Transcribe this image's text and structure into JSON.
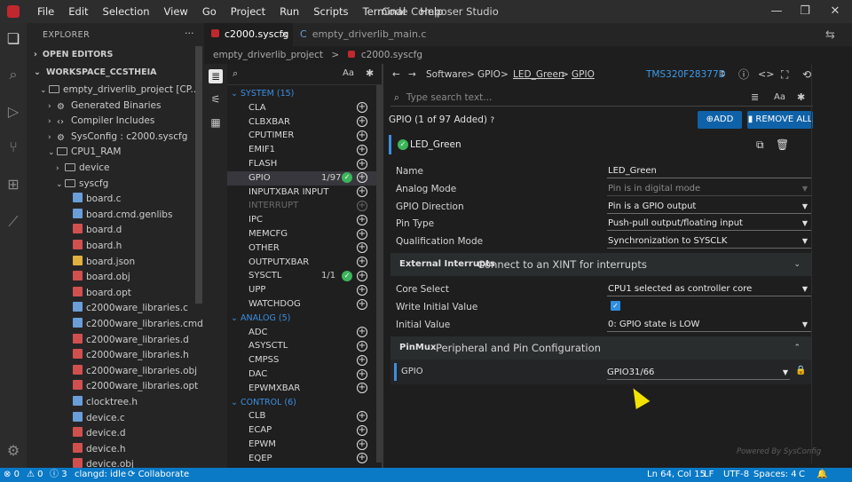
{
  "titlebar": {
    "menu": [
      "File",
      "Edit",
      "Selection",
      "View",
      "Go",
      "Project",
      "Run",
      "Scripts",
      "Terminal",
      "Help"
    ],
    "title": "Code Composer Studio"
  },
  "explorer": {
    "header": "EXPLORER",
    "open_editors": "OPEN EDITORS",
    "workspace": "WORKSPACE_CCSTHEIA",
    "tree": [
      {
        "label": "empty_driverlib_project [CP...",
        "indent": 1,
        "chev": "v",
        "icon": "folder"
      },
      {
        "label": "Generated Binaries",
        "indent": 2,
        "chev": ">",
        "icon": "gear"
      },
      {
        "label": "Compiler Includes",
        "indent": 2,
        "chev": ">",
        "icon": "code"
      },
      {
        "label": "SysConfig : c2000.syscfg",
        "indent": 2,
        "chev": ">",
        "icon": "gear"
      },
      {
        "label": "CPU1_RAM",
        "indent": 2,
        "chev": "v",
        "icon": "folder"
      },
      {
        "label": "device",
        "indent": 3,
        "chev": ">",
        "icon": "folder"
      },
      {
        "label": "syscfg",
        "indent": 3,
        "chev": "v",
        "icon": "folder"
      },
      {
        "label": "board.c",
        "indent": 4,
        "chev": "",
        "icon": "c"
      },
      {
        "label": "board.cmd.genlibs",
        "indent": 4,
        "chev": "",
        "icon": "c"
      },
      {
        "label": "board.d",
        "indent": 4,
        "chev": "",
        "icon": "red"
      },
      {
        "label": "board.h",
        "indent": 4,
        "chev": "",
        "icon": "red"
      },
      {
        "label": "board.json",
        "indent": 4,
        "chev": "",
        "icon": "yellow"
      },
      {
        "label": "board.obj",
        "indent": 4,
        "chev": "",
        "icon": "red"
      },
      {
        "label": "board.opt",
        "indent": 4,
        "chev": "",
        "icon": "red"
      },
      {
        "label": "c2000ware_libraries.c",
        "indent": 4,
        "chev": "",
        "icon": "c"
      },
      {
        "label": "c2000ware_libraries.cmd....",
        "indent": 4,
        "chev": "",
        "icon": "c"
      },
      {
        "label": "c2000ware_libraries.d",
        "indent": 4,
        "chev": "",
        "icon": "red"
      },
      {
        "label": "c2000ware_libraries.h",
        "indent": 4,
        "chev": "",
        "icon": "red"
      },
      {
        "label": "c2000ware_libraries.obj",
        "indent": 4,
        "chev": "",
        "icon": "red"
      },
      {
        "label": "c2000ware_libraries.opt",
        "indent": 4,
        "chev": "",
        "icon": "red"
      },
      {
        "label": "clocktree.h",
        "indent": 4,
        "chev": "",
        "icon": "c"
      },
      {
        "label": "device.c",
        "indent": 4,
        "chev": "",
        "icon": "c"
      },
      {
        "label": "device.d",
        "indent": 4,
        "chev": "",
        "icon": "red"
      },
      {
        "label": "device.h",
        "indent": 4,
        "chev": "",
        "icon": "red"
      },
      {
        "label": "device.obj",
        "indent": 4,
        "chev": "",
        "icon": "red"
      }
    ]
  },
  "tabs": [
    {
      "label": "c2000.syscfg",
      "close": "×"
    },
    {
      "label": "empty_driverlib_main.c"
    }
  ],
  "breadcrumb": {
    "project": "empty_driverlib_project",
    "sep": ">",
    "file": "c2000.syscfg"
  },
  "modules": {
    "search_aa": "Aa",
    "rows": [
      {
        "kind": "cat",
        "label": "SYSTEM (15)"
      },
      {
        "label": "CLA"
      },
      {
        "label": "CLBXBAR"
      },
      {
        "label": "CPUTIMER"
      },
      {
        "label": "EMIF1"
      },
      {
        "label": "FLASH"
      },
      {
        "label": "GPIO",
        "count": "1/97",
        "added": true,
        "selected": true
      },
      {
        "label": "INPUTXBAR INPUT"
      },
      {
        "label": "INTERRUPT",
        "disabled": true
      },
      {
        "label": "IPC"
      },
      {
        "label": "MEMCFG"
      },
      {
        "label": "OTHER"
      },
      {
        "label": "OUTPUTXBAR"
      },
      {
        "label": "SYSCTL",
        "count": "1/1",
        "added": true
      },
      {
        "label": "UPP"
      },
      {
        "label": "WATCHDOG"
      },
      {
        "kind": "cat",
        "label": "ANALOG (5)"
      },
      {
        "label": "ADC"
      },
      {
        "label": "ASYSCTL"
      },
      {
        "label": "CMPSS"
      },
      {
        "label": "DAC"
      },
      {
        "label": "EPWMXBAR"
      },
      {
        "kind": "cat",
        "label": "CONTROL (6)"
      },
      {
        "label": "CLB"
      },
      {
        "label": "ECAP"
      },
      {
        "label": "EPWM"
      },
      {
        "label": "EQEP"
      }
    ]
  },
  "config": {
    "nav": {
      "software": "Software",
      "gpio": "GPIO",
      "led": "LED_Green",
      "gpio2": "GPIO",
      "sep": ">"
    },
    "device": "TMS320F28377D",
    "search_placeholder": "Type search text...",
    "aa": "Aa",
    "gpio_header": "GPIO (1 of 97 Added)",
    "add_label": "ADD",
    "remove_all_label": "REMOVE ALL",
    "instance_name": "LED_Green",
    "fields": [
      {
        "label": "Name",
        "value": "LED_Green",
        "dropdown": false
      },
      {
        "label": "Analog Mode",
        "value": "Pin is in digital mode",
        "dropdown": true,
        "disabled": true
      },
      {
        "label": "GPIO Direction",
        "value": "Pin is a GPIO output",
        "dropdown": true
      },
      {
        "label": "Pin Type",
        "value": "Push-pull output/floating input",
        "dropdown": true
      },
      {
        "label": "Qualification Mode",
        "value": "Synchronization to SYSCLK",
        "dropdown": true
      }
    ],
    "ext_int": {
      "title": "External Interrupts",
      "desc": "Connect to an XINT for interrupts"
    },
    "fields2": [
      {
        "label": "Core Select",
        "value": "CPU1 selected as controller core",
        "dropdown": true
      },
      {
        "label": "Write Initial Value",
        "checkbox": true
      },
      {
        "label": "Initial Value",
        "value": "0: GPIO state is LOW",
        "dropdown": true
      }
    ],
    "pinmux": {
      "title": "PinMux",
      "desc": "Peripheral and Pin Configuration",
      "gpio_label": "GPIO",
      "gpio_value": "GPIO31/66"
    },
    "powered": "Powered By SysConfig"
  },
  "status": {
    "errors": "0",
    "warnings": "0",
    "info": "3",
    "clangd": "clangd: idle",
    "collaborate": "Collaborate",
    "pos": "Ln 64, Col 15",
    "eol": "LF",
    "enc": "UTF-8",
    "spaces": "Spaces: 4",
    "lang": "C"
  },
  "colors": {
    "accent": "#0a79c6",
    "added": "#3cb55a",
    "button": "#0f62a8"
  }
}
